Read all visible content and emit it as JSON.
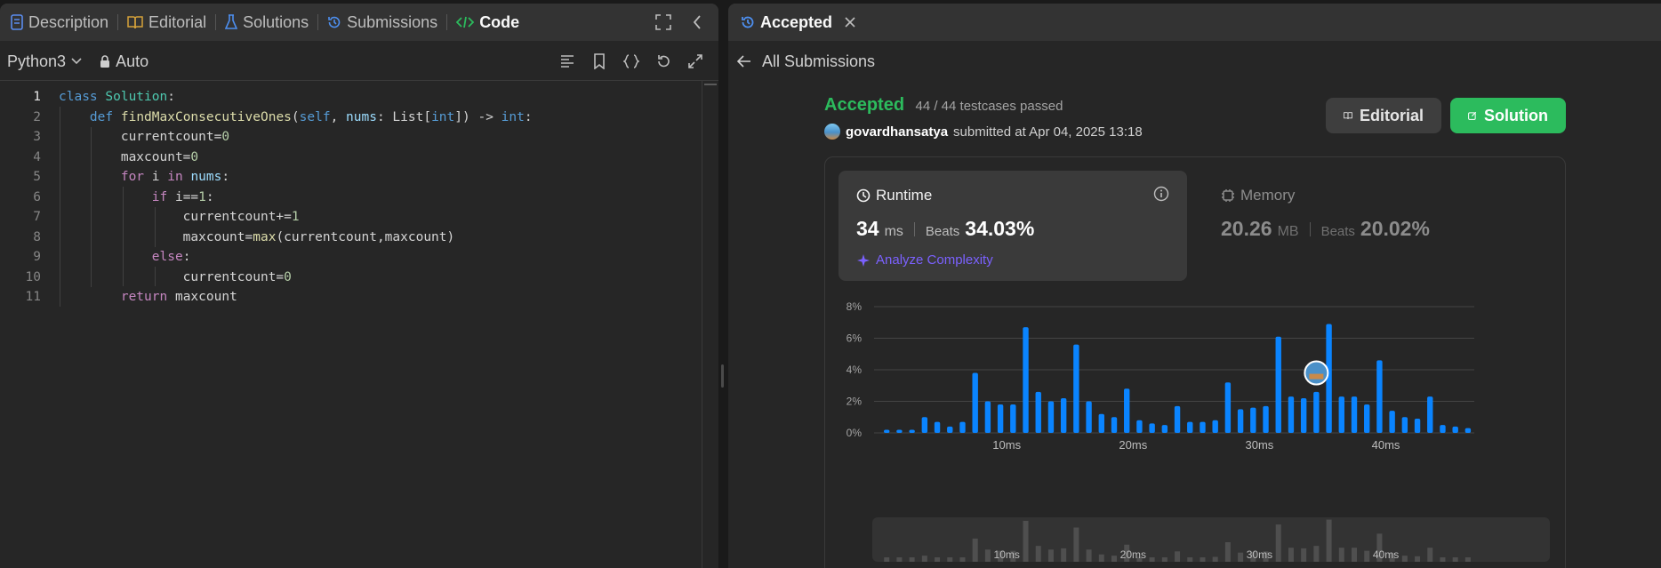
{
  "left_tabs": [
    {
      "label": "Description",
      "icon": "description-icon"
    },
    {
      "label": "Editorial",
      "icon": "book-icon"
    },
    {
      "label": "Solutions",
      "icon": "flask-icon"
    },
    {
      "label": "Submissions",
      "icon": "history-icon"
    },
    {
      "label": "Code",
      "icon": "code-icon"
    }
  ],
  "language": "Python3",
  "auto_label": "Auto",
  "code_lines": [
    "class Solution:",
    "    def findMaxConsecutiveOnes(self, nums: List[int]) -> int:",
    "        currentcount=0",
    "        maxcount=0",
    "        for i in nums:",
    "            if i==1:",
    "                currentcount+=1",
    "                maxcount=max(currentcount,maxcount)",
    "            else:",
    "                currentcount=0",
    "        return maxcount"
  ],
  "right_tab": {
    "label": "Accepted"
  },
  "back_label": "All Submissions",
  "result": {
    "status": "Accepted",
    "testcases": "44 / 44 testcases passed",
    "username": "govardhansatya",
    "submitted": "submitted at Apr 04, 2025 13:18"
  },
  "buttons": {
    "editorial": "Editorial",
    "solution": "Solution"
  },
  "runtime": {
    "title": "Runtime",
    "value": "34",
    "unit": "ms",
    "beats_label": "Beats",
    "beats": "34.03%",
    "analyze": "Analyze Complexity"
  },
  "memory": {
    "title": "Memory",
    "value": "20.26",
    "unit": "MB",
    "beats_label": "Beats",
    "beats": "20.02%"
  },
  "colors": {
    "accent_green": "#2cbb5d",
    "bar_blue": "#0a84ff",
    "analyze_purple": "#7b61ff"
  },
  "chart_data": {
    "type": "bar",
    "x": [
      0.5,
      1.5,
      2.5,
      3.5,
      4.5,
      5.5,
      6.5,
      7.5,
      8.5,
      9.5,
      10.5,
      11.5,
      12.5,
      13.5,
      14.5,
      15.5,
      16.5,
      17.5,
      18.5,
      19.5,
      20.5,
      21.5,
      22.5,
      23.5,
      24.5,
      25.5,
      26.5,
      27.5,
      28.5,
      29.5,
      30.5,
      31.5,
      32.5,
      33.5,
      34.5,
      35.5,
      36.5,
      37.5,
      38.5,
      39.5,
      40.5,
      41.5,
      42.5,
      43.5,
      44.5,
      45.5
    ],
    "values": [
      0.2,
      0.2,
      0.2,
      1.0,
      0.7,
      0.4,
      0.7,
      3.8,
      2.0,
      1.8,
      1.8,
      6.7,
      2.6,
      2.0,
      2.2,
      5.6,
      2.0,
      1.2,
      1.0,
      2.8,
      0.8,
      0.6,
      0.5,
      1.7,
      0.7,
      0.7,
      0.8,
      3.2,
      1.5,
      1.6,
      1.7,
      6.1,
      2.3,
      2.2,
      2.6,
      6.9,
      2.3,
      2.3,
      1.8,
      4.6,
      1.4,
      1.0,
      0.9,
      2.3,
      0.5,
      0.4,
      0.3
    ],
    "xticks": [
      {
        "value": 10,
        "label": "10ms"
      },
      {
        "value": 20,
        "label": "20ms"
      },
      {
        "value": 30,
        "label": "30ms"
      },
      {
        "value": 40,
        "label": "40ms"
      }
    ],
    "yticks": [
      {
        "value": 0,
        "label": "0%"
      },
      {
        "value": 2,
        "label": "2%"
      },
      {
        "value": 4,
        "label": "4%"
      },
      {
        "value": 6,
        "label": "6%"
      },
      {
        "value": 8,
        "label": "8%"
      }
    ],
    "xlim": [
      -0.5,
      47
    ],
    "ylim": [
      0,
      8
    ],
    "user_marker_x": 34,
    "user_marker_y": 3.8
  }
}
